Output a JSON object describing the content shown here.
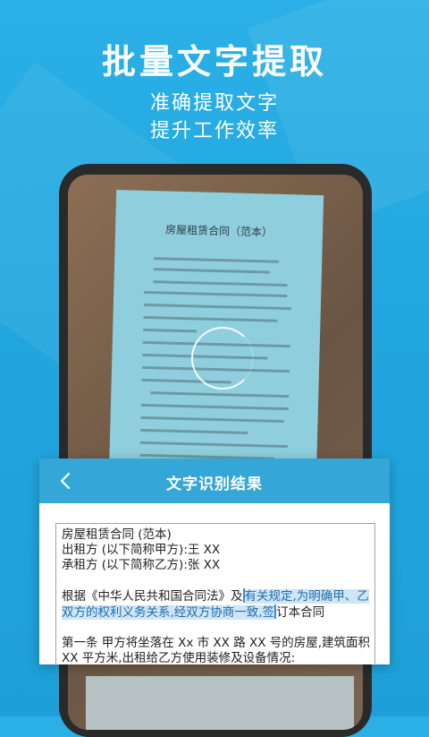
{
  "promo": {
    "headline": "批量文字提取",
    "subline1": "准确提取文字",
    "subline2": "提升工作效率"
  },
  "document_photo": {
    "title": "房屋租赁合同（范本）"
  },
  "result_panel": {
    "title": "文字识别结果",
    "back_icon": "chevron-left-icon",
    "text": {
      "line1": "房屋租赁合同 (范本)",
      "line2": "出租方 (以下简称甲方):王 XX",
      "line3": "承租方 (以下简称乙方):张 XX",
      "line4_pre": "根据《中华人民共和国合同法》及",
      "line4_hl": "有关规定,为明确甲、乙",
      "line5_hl": "双方的权利义务关系,经双方协商一致,签",
      "line5_post": "订本合同",
      "line6": "第一条  甲方将坐落在 Xx 市 XX 路 XX 号的房屋,建筑面积",
      "line7": "XX 平方米,出租给乙方使用装修及设备情况:"
    }
  },
  "colors": {
    "background": "#22a6df",
    "header": "#34a6d8",
    "highlight_text": "#1d6fae"
  }
}
